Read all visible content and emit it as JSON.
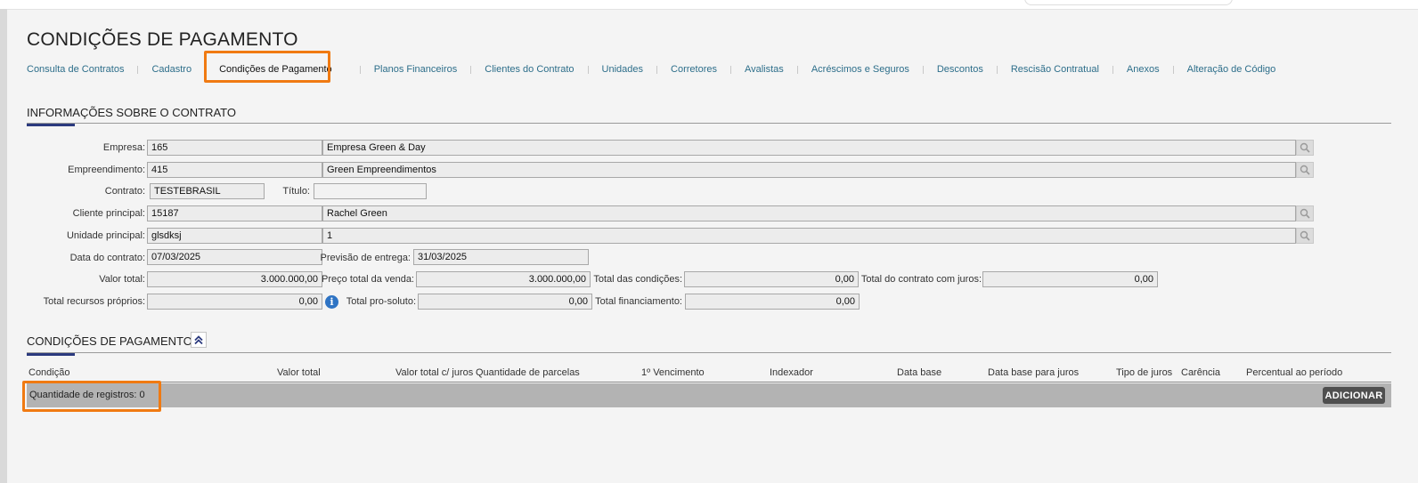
{
  "page": {
    "title": "CONDIÇÕES DE PAGAMENTO"
  },
  "tabs": [
    {
      "label": "Consulta de Contratos"
    },
    {
      "label": "Cadastro"
    },
    {
      "label": "Condições de Pagamento",
      "active": true
    },
    {
      "label": "Planos Financeiros"
    },
    {
      "label": "Clientes do Contrato"
    },
    {
      "label": "Unidades"
    },
    {
      "label": "Corretores"
    },
    {
      "label": "Avalistas"
    },
    {
      "label": "Acréscimos e Seguros"
    },
    {
      "label": "Descontos"
    },
    {
      "label": "Rescisão Contratual"
    },
    {
      "label": "Anexos"
    },
    {
      "label": "Alteração de Código"
    }
  ],
  "contract_info": {
    "title": "INFORMAÇÕES SOBRE O CONTRATO",
    "empresa": {
      "label": "Empresa:",
      "code": "165",
      "name": "Empresa Green & Day"
    },
    "empreendimento": {
      "label": "Empreendimento:",
      "code": "415",
      "name": "Green Empreendimentos"
    },
    "contrato": {
      "label": "Contrato:",
      "value": "TESTEBRASIL"
    },
    "titulo": {
      "label": "Título:",
      "value": ""
    },
    "cliente_principal": {
      "label": "Cliente principal:",
      "code": "15187",
      "name": "Rachel Green"
    },
    "unidade_principal": {
      "label": "Unidade principal:",
      "code": "glsdksj",
      "name": "1"
    },
    "data_contrato": {
      "label": "Data do contrato:",
      "value": "07/03/2025"
    },
    "previsao_entrega": {
      "label": "Previsão de entrega:",
      "value": "31/03/2025"
    },
    "valor_total": {
      "label": "Valor total:",
      "value": "3.000.000,00"
    },
    "preco_total_venda": {
      "label": "Preço total da venda:",
      "value": "3.000.000,00"
    },
    "total_condicoes": {
      "label": "Total das condições:",
      "value": "0,00"
    },
    "total_contrato_juros": {
      "label": "Total do contrato com juros:",
      "value": "0,00"
    },
    "total_recursos_proprios": {
      "label": "Total recursos próprios:",
      "value": "0,00"
    },
    "total_pro_soluto": {
      "label": "Total pro-soluto:",
      "value": "0,00"
    },
    "total_financiamento": {
      "label": "Total financiamento:",
      "value": "0,00"
    }
  },
  "payment_conditions": {
    "title": "CONDIÇÕES DE PAGAMENTO",
    "columns": [
      "Condição",
      "Valor total",
      "Valor total c/ juros",
      "Quantidade de parcelas",
      "1º Vencimento",
      "Indexador",
      "Data base",
      "Data base para juros",
      "Tipo de juros",
      "Carência",
      "Percentual ao período"
    ],
    "rows": [],
    "record_count": "Quantidade de registros: 0",
    "add_label": "ADICIONAR"
  },
  "colors": {
    "accent": "#2b3a7e",
    "highlight": "#f07a12",
    "link": "#2d6e8a"
  }
}
